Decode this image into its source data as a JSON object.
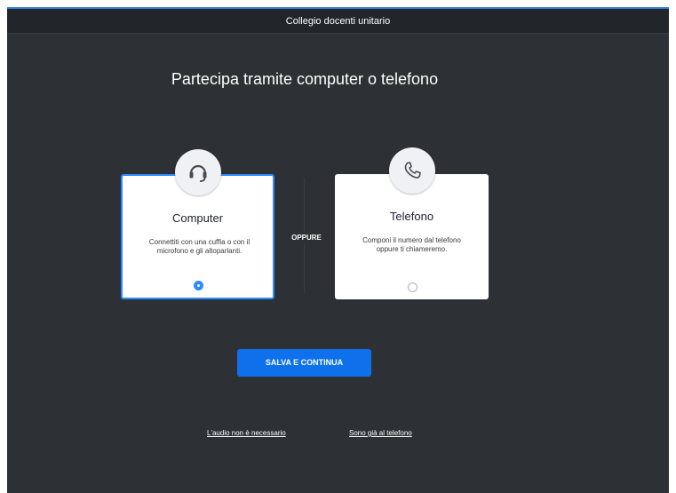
{
  "window": {
    "title": "Collegio docenti unitario"
  },
  "heading": "Partecipa tramite computer o telefono",
  "options": [
    {
      "title": "Computer",
      "description": "Connettiti con una cuffia o con il microfono e gli altoparlanti.",
      "icon": "headset-icon",
      "selected": true
    },
    {
      "title": "Telefono",
      "description": "Componi il numero dal telefono oppure ti chiameremo.",
      "icon": "phone-icon",
      "selected": false
    }
  ],
  "separator": "OPPURE",
  "primary_button": "SALVA E CONTINUA",
  "links": {
    "no_audio": "L'audio non è necessario",
    "already_on_phone": "Sono già al telefono"
  },
  "colors": {
    "background": "#2d3035",
    "accent": "#0e71eb",
    "selected_border": "#2d8cff"
  }
}
